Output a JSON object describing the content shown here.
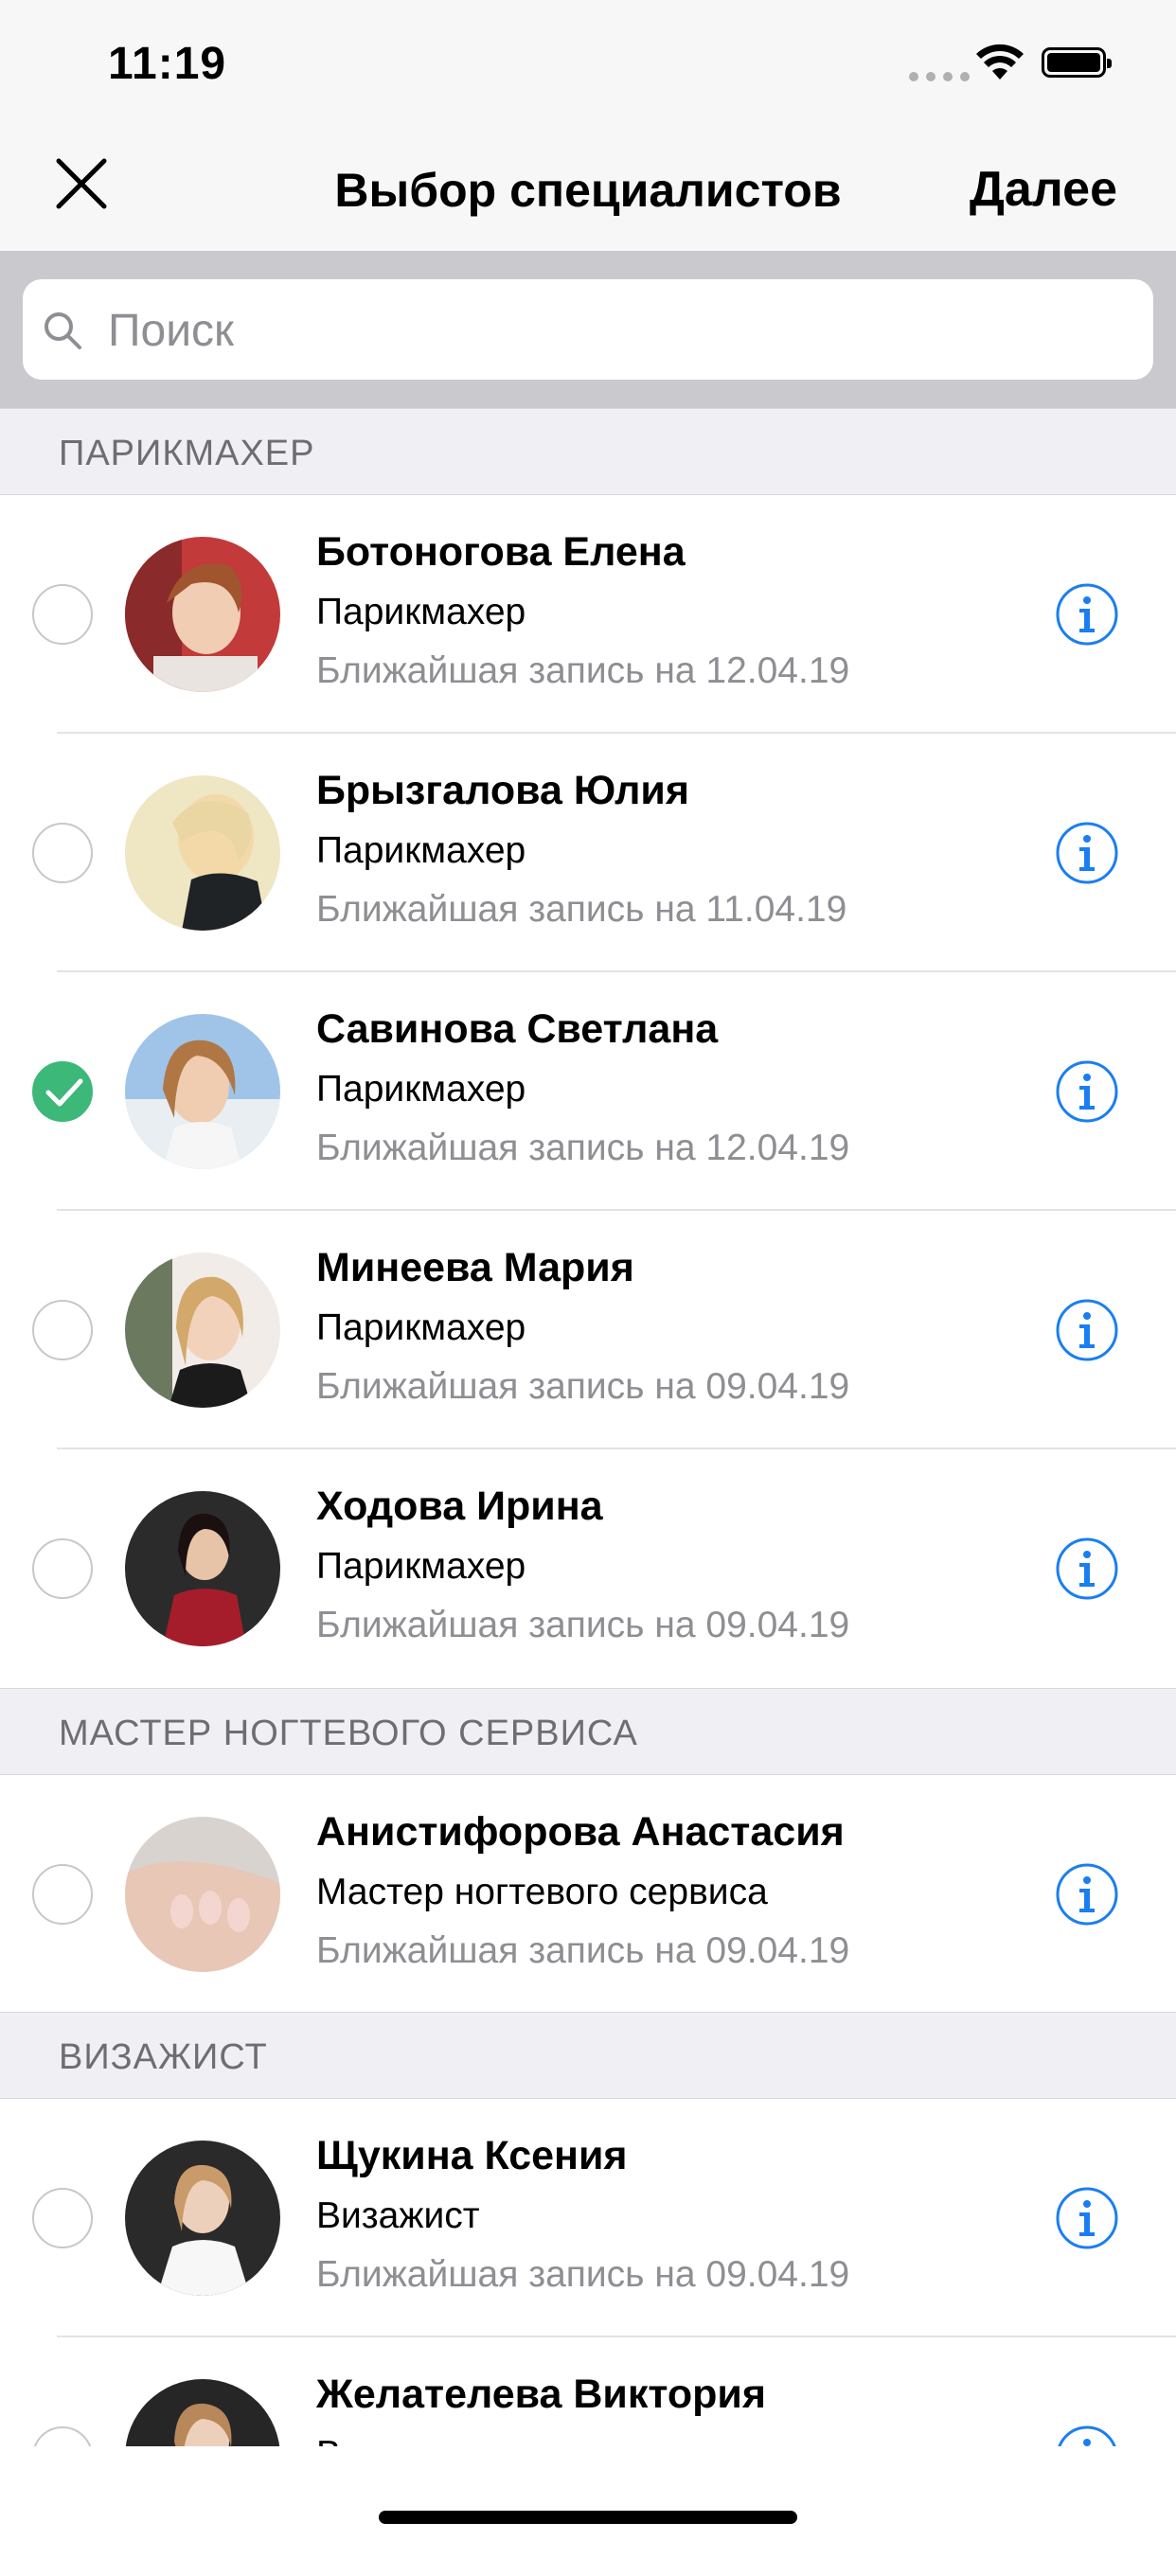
{
  "status_bar": {
    "time": "11:19"
  },
  "nav": {
    "title": "Выбор специалистов",
    "next_label": "Далее"
  },
  "search": {
    "placeholder": "Поиск"
  },
  "colors": {
    "accent": "#1a7ef2",
    "check_green": "#3cb878",
    "section_bg": "#efeff4",
    "secondary_text": "#8e8e93"
  },
  "sections": [
    {
      "title": "ПАРИКМАХЕР",
      "items": [
        {
          "name": "Ботоногова Елена",
          "role": "Парикмахер",
          "next": "Ближайшая запись на 12.04.19",
          "selected": false
        },
        {
          "name": "Брызгалова Юлия",
          "role": "Парикмахер",
          "next": "Ближайшая запись на 11.04.19",
          "selected": false
        },
        {
          "name": "Савинова Светлана",
          "role": "Парикмахер",
          "next": "Ближайшая запись на 12.04.19",
          "selected": true
        },
        {
          "name": "Минеева Мария",
          "role": "Парикмахер",
          "next": "Ближайшая запись на 09.04.19",
          "selected": false
        },
        {
          "name": "Ходова Ирина",
          "role": "Парикмахер",
          "next": "Ближайшая запись на 09.04.19",
          "selected": false
        }
      ]
    },
    {
      "title": "МАСТЕР НОГТЕВОГО СЕРВИСА",
      "items": [
        {
          "name": "Анистифорова Анастасия",
          "role": "Мастер ногтевого сервиса",
          "next": "Ближайшая запись на 09.04.19",
          "selected": false
        }
      ]
    },
    {
      "title": "ВИЗАЖИСТ",
      "items": [
        {
          "name": "Щукина Ксения",
          "role": "Визажист",
          "next": "Ближайшая запись на 09.04.19",
          "selected": false
        },
        {
          "name": "Желателева Виктория",
          "role": "Визажист",
          "next": "",
          "selected": false
        }
      ]
    }
  ]
}
